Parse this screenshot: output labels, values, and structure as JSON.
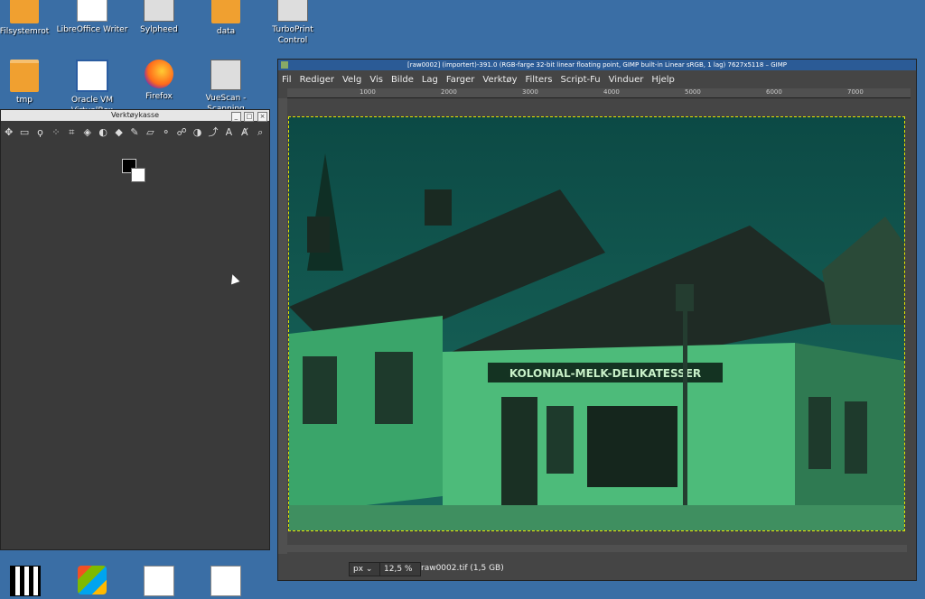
{
  "desktop": {
    "icons": [
      {
        "label": "Filsystemrot",
        "icon": "folder-icon"
      },
      {
        "label": "LibreOffice Writer",
        "icon": "writer-document-icon"
      },
      {
        "label": "Sylpheed",
        "icon": "mail-client-icon"
      },
      {
        "label": "data",
        "icon": "folder-icon"
      },
      {
        "label": "TurboPrint Control",
        "icon": "printer-icon"
      },
      {
        "label": "tmp",
        "icon": "folder-icon"
      },
      {
        "label": "Oracle VM VirtualBox",
        "icon": "virtualbox-icon"
      },
      {
        "label": "Firefox",
        "icon": "firefox-icon"
      },
      {
        "label": "VueScan - Scanning",
        "icon": "scanner-icon"
      }
    ],
    "bottom_icons": [
      "video-clapper-icon",
      "windows-logo-icon",
      "text-document-icon",
      "blank-document-icon"
    ]
  },
  "toolbox": {
    "title": "Verktøykasse",
    "tools": [
      "move-icon",
      "rectangle-select-icon",
      "free-select-icon",
      "fuzzy-select-icon",
      "crop-icon",
      "transform-icon",
      "warp-icon",
      "bucket-fill-icon",
      "paintbrush-icon",
      "eraser-icon",
      "clone-icon",
      "smudge-icon",
      "dodge-icon",
      "path-icon",
      "text-icon",
      "color-picker-icon",
      "zoom-icon"
    ],
    "fg_color": "#000000",
    "bg_color": "#ffffff"
  },
  "gimp": {
    "title": "[raw0002] (importert)-391.0 (RGB-farge 32-bit linear floating point, GIMP built-in Linear sRGB, 1 lag) 7627x5118 – GIMP",
    "menu": [
      "Fil",
      "Rediger",
      "Velg",
      "Vis",
      "Bilde",
      "Lag",
      "Farger",
      "Verktøy",
      "Filters",
      "Script-Fu",
      "Vinduer",
      "Hjelp"
    ],
    "ruler_ticks": [
      "1000",
      "2000",
      "3000",
      "4000",
      "5000",
      "6000",
      "7000"
    ],
    "unit": "px",
    "zoom": "12,5 %",
    "file_info": "raw0002.tif (1,5 GB)",
    "sign_text": "KOLONIAL-MELK-DELIKATESSER"
  }
}
